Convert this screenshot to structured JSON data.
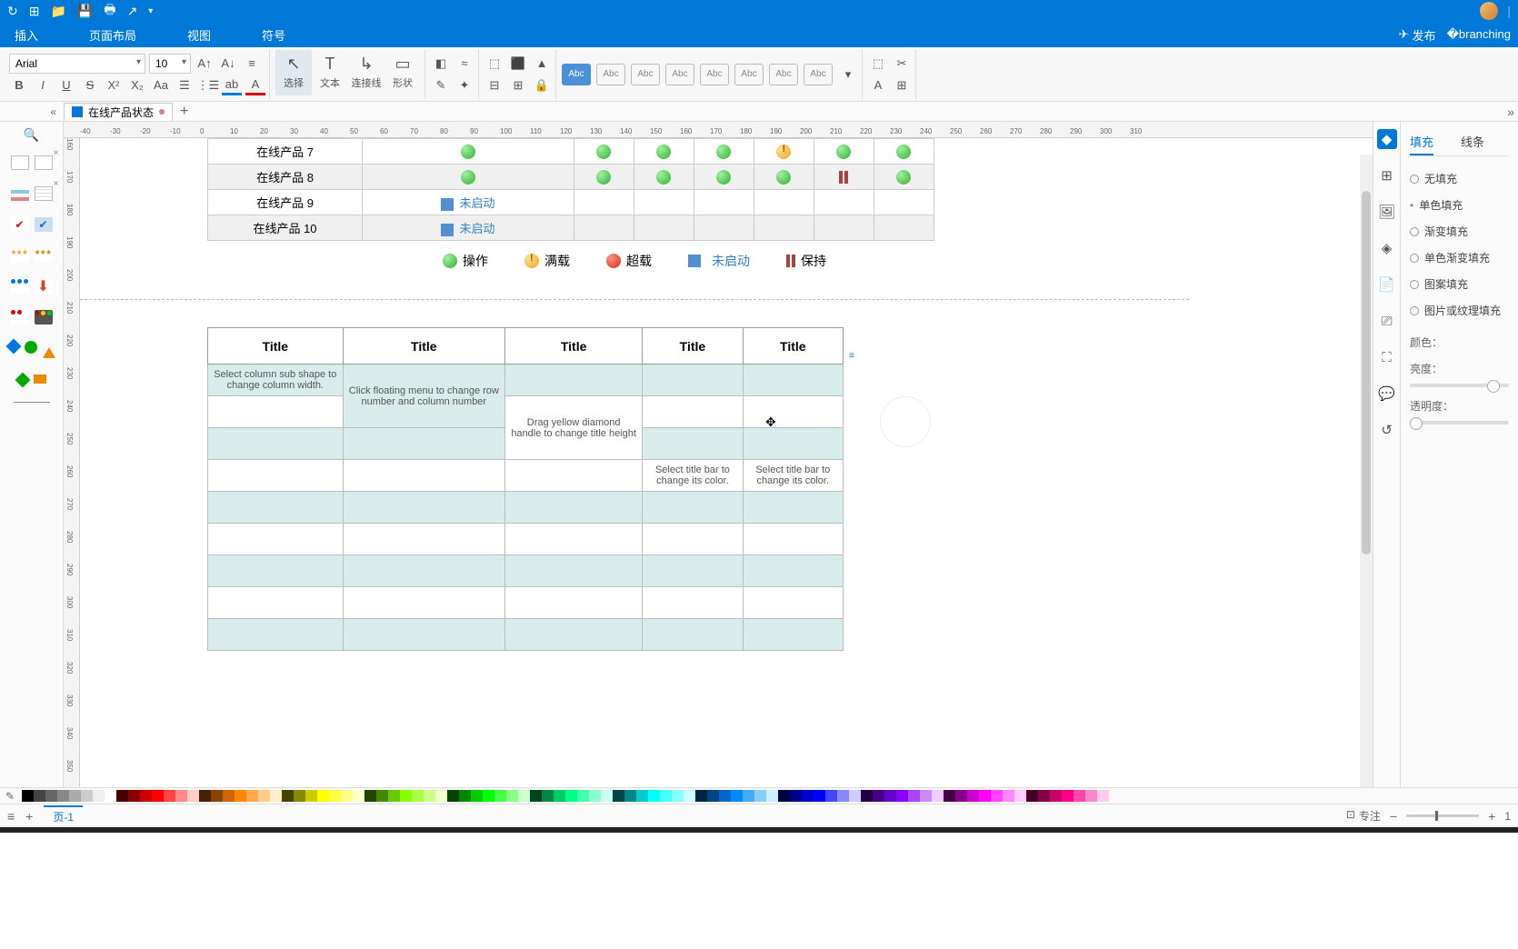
{
  "menu": {
    "insert": "插入",
    "layout": "页面布局",
    "view": "视图",
    "symbol": "符号",
    "publish": "发布"
  },
  "toolbar": {
    "font": "Arial",
    "size": "10",
    "tools": {
      "select": "选择",
      "text": "文本",
      "connector": "连接线",
      "shape": "形状"
    },
    "preset_label": "Abc"
  },
  "tab": {
    "name": "在线产品状态"
  },
  "status_rows": [
    {
      "label": "在线产品 7",
      "cells": [
        "green",
        "green",
        "green",
        "green",
        "warn",
        "green",
        "green"
      ]
    },
    {
      "label": "在线产品 8",
      "cells": [
        "green",
        "green",
        "green",
        "green",
        "green",
        "bars",
        "green"
      ]
    },
    {
      "label": "在线产品 9",
      "cells": [
        "not_started",
        "",
        "",
        "",
        "",
        "",
        ""
      ]
    },
    {
      "label": "在线产品 10",
      "cells": [
        "not_started",
        "",
        "",
        "",
        "",
        "",
        ""
      ]
    }
  ],
  "not_started_text": "未启动",
  "legend": {
    "op": "操作",
    "full": "满载",
    "over": "超载",
    "not_started": "未启动",
    "hold": "保持"
  },
  "title_table": {
    "headers": [
      "Title",
      "Title",
      "Title",
      "Title",
      "Title"
    ],
    "hints": {
      "c0": "Select column sub shape to change column width.",
      "c1": "Click floating menu to change row number and column number",
      "c2": "Drag yellow diamond handle to change title height",
      "c3": "Select title bar to change its color.",
      "c4": "Select title bar to change its color."
    }
  },
  "right_panel": {
    "tab_fill": "填充",
    "tab_line": "线条",
    "opts": {
      "none": "无填充",
      "solid": "单色填充",
      "gradient": "渐变填充",
      "mono_grad": "单色渐变填充",
      "pattern": "图案填充",
      "image": "图片或纹理填充"
    },
    "color": "颜色：",
    "brightness": "亮度：",
    "opacity": "透明度："
  },
  "pagebar": {
    "page": "页-1",
    "focus": "专注",
    "zoom": "1"
  },
  "ruler_h": [
    -40,
    -30,
    -20,
    -10,
    0,
    10,
    20,
    30,
    40,
    50,
    60,
    70,
    80,
    90,
    100,
    110,
    120,
    130,
    140,
    150,
    160,
    170,
    180,
    190,
    200,
    210,
    220,
    230,
    240,
    250,
    260,
    270,
    280,
    290,
    300,
    310
  ],
  "ruler_v": [
    160,
    170,
    180,
    190,
    200,
    210,
    220,
    230,
    240,
    250,
    260,
    270,
    280,
    290,
    300,
    310,
    320,
    330,
    340,
    350
  ],
  "colors": [
    "#000",
    "#444",
    "#666",
    "#888",
    "#aaa",
    "#ccc",
    "#eee",
    "#fff",
    "#400",
    "#800",
    "#c00",
    "#f00",
    "#f44",
    "#f88",
    "#fcc",
    "#420",
    "#840",
    "#c60",
    "#f80",
    "#fa4",
    "#fc8",
    "#fec",
    "#440",
    "#880",
    "#cc0",
    "#ff0",
    "#ff4",
    "#ff8",
    "#ffc",
    "#240",
    "#480",
    "#6c0",
    "#8f0",
    "#af4",
    "#cf8",
    "#efc",
    "#040",
    "#080",
    "#0c0",
    "#0f0",
    "#4f4",
    "#8f8",
    "#cfc",
    "#042",
    "#084",
    "#0c6",
    "#0f8",
    "#4fa",
    "#8fc",
    "#cfe",
    "#044",
    "#088",
    "#0cc",
    "#0ff",
    "#4ff",
    "#8ff",
    "#cff",
    "#024",
    "#048",
    "#06c",
    "#08f",
    "#4af",
    "#8cf",
    "#cef",
    "#004",
    "#008",
    "#00c",
    "#00f",
    "#44f",
    "#88f",
    "#ccf",
    "#204",
    "#408",
    "#60c",
    "#80f",
    "#a4f",
    "#c8f",
    "#ecf",
    "#404",
    "#808",
    "#c0c",
    "#f0f",
    "#f4f",
    "#f8f",
    "#fcf",
    "#402",
    "#804",
    "#c06",
    "#f08",
    "#f4a",
    "#f8c",
    "#fce"
  ]
}
